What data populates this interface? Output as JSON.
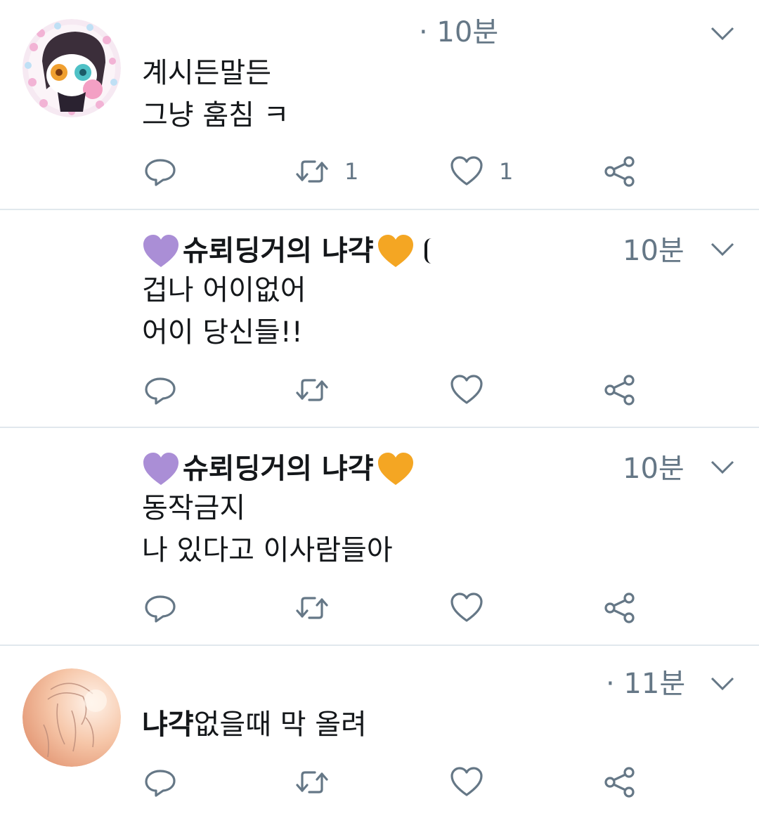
{
  "tweets": [
    {
      "has_avatar": true,
      "time": "· 10분",
      "lines": [
        "계시든말든",
        "그냥 훔침 ㅋ"
      ],
      "reply_count": "",
      "retweet_count": "1",
      "like_count": "1"
    },
    {
      "has_avatar": false,
      "name": "슈뢰딩거의 냐갹",
      "time": "10분",
      "lines": [
        "겁나 어이없어",
        "어이 당신들!!"
      ],
      "retweet_count": "",
      "like_count": ""
    },
    {
      "has_avatar": false,
      "name": "슈뢰딩거의 냐갹",
      "time": "10분",
      "lines": [
        "동작금지",
        "나 있다고 이사람들아"
      ],
      "retweet_count": "",
      "like_count": ""
    },
    {
      "has_avatar": true,
      "time": "· 11분",
      "text_bold": "냐갹",
      "text_rest": "없을때 막 올려",
      "retweet_count": "",
      "like_count": ""
    }
  ],
  "colors": {
    "text": "#14171a",
    "secondary": "#657786",
    "divider": "#e1e8ed",
    "purple_heart": "#aa8ed6",
    "orange_heart": "#f4a623"
  },
  "icons": [
    "reply-icon",
    "retweet-icon",
    "like-icon",
    "share-icon",
    "chevron-down-icon",
    "purple-heart-icon",
    "orange-heart-icon"
  ]
}
